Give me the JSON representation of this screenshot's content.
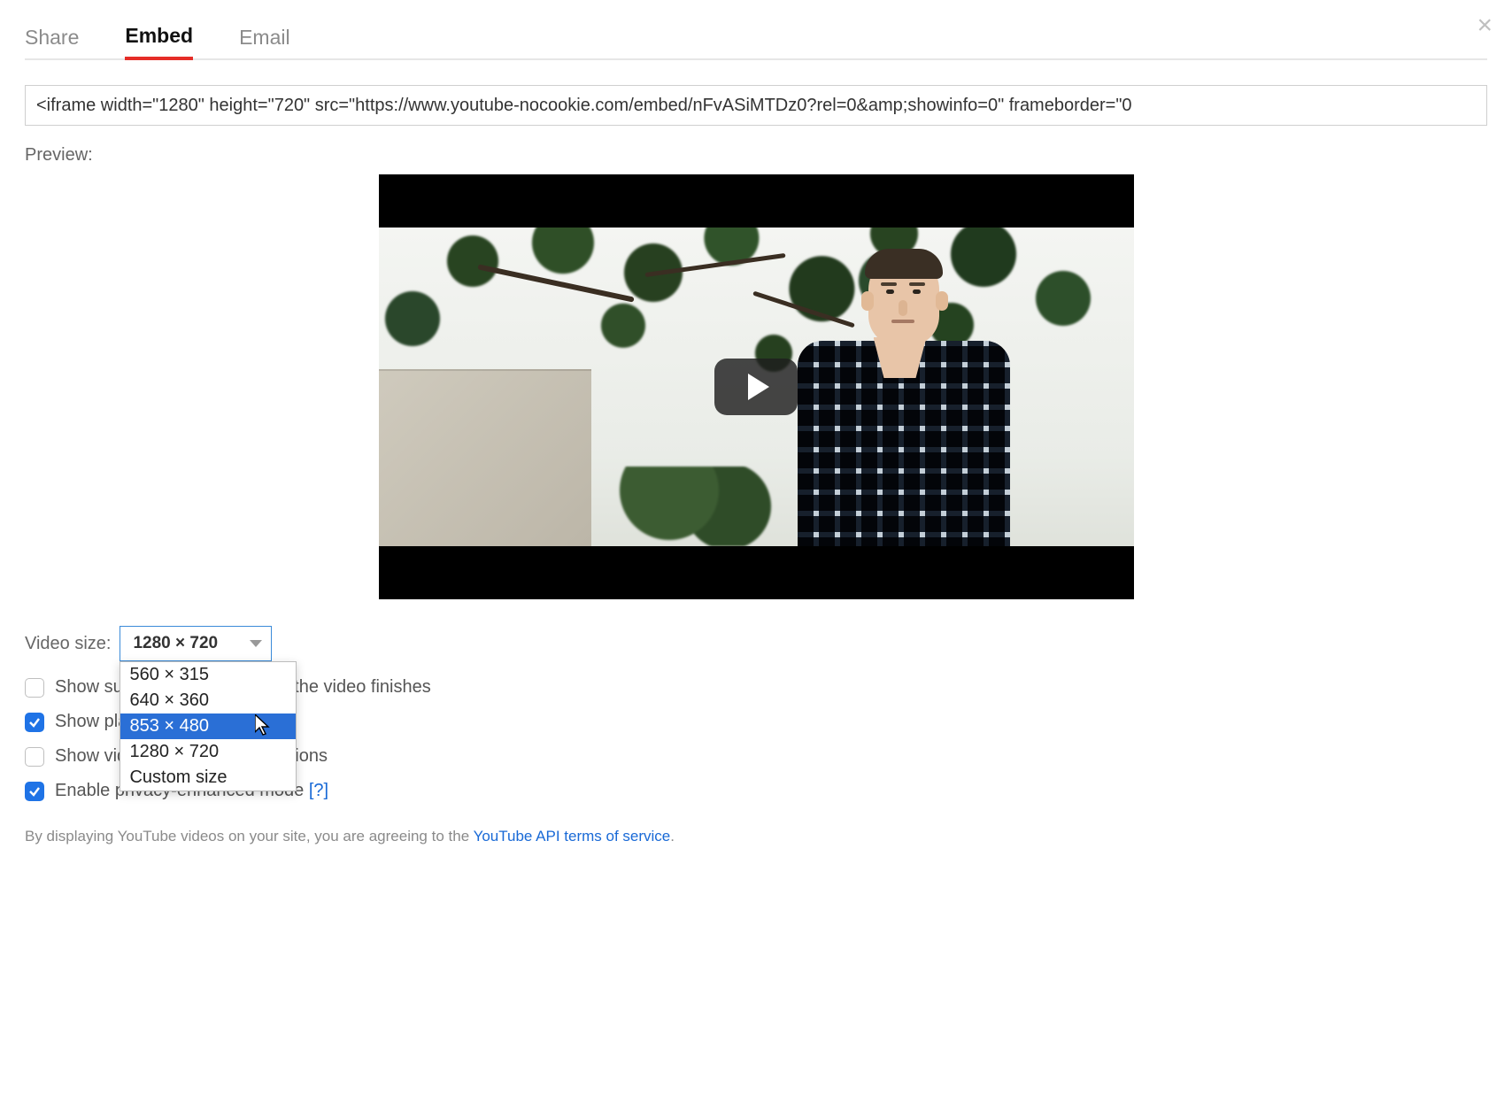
{
  "tabs": {
    "share": "Share",
    "embed": "Embed",
    "email": "Email",
    "active": "embed"
  },
  "close": "×",
  "embed_code": "<iframe width=\"1280\" height=\"720\" src=\"https://www.youtube-nocookie.com/embed/nFvASiMTDz0?rel=0&amp;showinfo=0\" frameborder=\"0",
  "preview_label": "Preview:",
  "video_size": {
    "label": "Video size:",
    "selected": "1280 × 720",
    "options": [
      "560 × 315",
      "640 × 360",
      "853 × 480",
      "1280 × 720",
      "Custom size"
    ],
    "highlighted_index": 2
  },
  "options": {
    "suggested": {
      "label": "Show suggested videos when the video finishes",
      "checked": false,
      "partially_hidden_label_left": "Show su",
      "partially_hidden_label_right": "hen the video finishes"
    },
    "controls": {
      "label": "Show player controls",
      "checked": true,
      "partially_hidden_label_left": "Show pl",
      "partially_hidden_label_right": ""
    },
    "title": {
      "label": "Show video title and player actions",
      "checked": false,
      "partially_hidden_label_left": "Show vi",
      "partially_hidden_label_right": "r actions"
    },
    "privacy": {
      "label": "Enable privacy-enhanced mode ",
      "checked": true,
      "help": "[?]"
    }
  },
  "terms": {
    "prefix": "By displaying YouTube videos on your site, you are agreeing to the ",
    "link": "YouTube API terms of service",
    "suffix": "."
  }
}
